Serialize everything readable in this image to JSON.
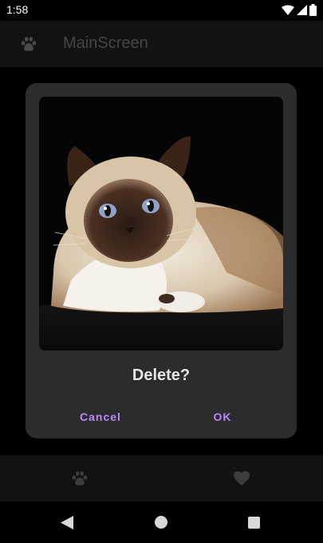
{
  "status_bar": {
    "time": "1:58",
    "icons": [
      "wifi-icon",
      "signal-icon",
      "battery-icon"
    ]
  },
  "app_bar": {
    "icon": "paw-icon",
    "title": "MainScreen"
  },
  "dialog": {
    "image": "cat-photo",
    "title": "Delete?",
    "cancel_label": "Cancel",
    "ok_label": "OK"
  },
  "bottom_nav": {
    "items": [
      {
        "icon": "paw-icon"
      },
      {
        "icon": "heart-icon"
      }
    ]
  },
  "system_nav": {
    "icons": [
      "back-icon",
      "home-icon",
      "recents-icon"
    ]
  },
  "colors": {
    "accent": "#bb86fc",
    "dialog_bg": "#2c2c2c",
    "bar_bg": "#121212"
  }
}
